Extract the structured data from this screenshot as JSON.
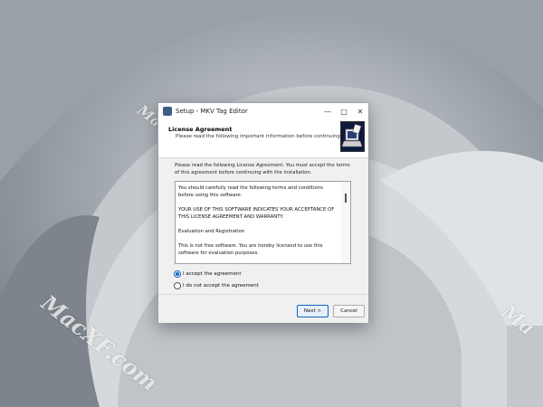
{
  "window": {
    "title": "Setup - MKV Tag Editor",
    "minimize_icon": "minimize-icon",
    "maximize_icon": "maximize-icon",
    "close_icon": "close-icon"
  },
  "header": {
    "title": "License Agreement",
    "subtitle": "Please read the following important information before continuing.",
    "logo_icon": "installer-logo-icon"
  },
  "intro_text": "Please read the following License Agreement. You must accept the terms of this agreement before continuing with the installation.",
  "license": {
    "paragraphs": [
      "You should carefully read the following terms and conditions before using this software.",
      "YOUR USE OF THIS SOFTWARE INDICATES YOUR ACCEPTANCE OF THIS LICENSE AGREEMENT AND WARRANTY.",
      "Evaluation and Registration",
      "This is not free software. You are hereby licensed to use this software for evaluation purposes."
    ]
  },
  "options": {
    "accept": "I accept the agreement",
    "decline": "I do not accept the agreement",
    "selected": "accept"
  },
  "buttons": {
    "next": "Next >",
    "cancel": "Cancel"
  },
  "watermark": {
    "text_small": "MacXF.com",
    "text_large": "MacXF.com",
    "text_edge": "Ma"
  },
  "colors": {
    "accent": "#1565c0",
    "logo_bg": "#0e1a3d"
  }
}
